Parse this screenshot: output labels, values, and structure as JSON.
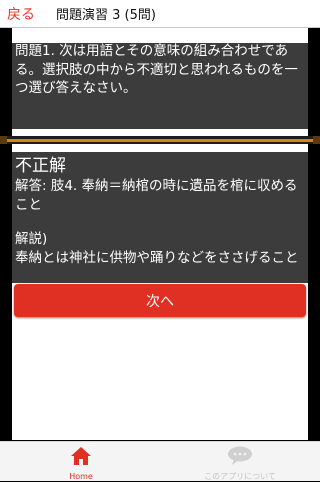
{
  "header": {
    "back_label": "戻る",
    "title": "問題演習 3 (5問)"
  },
  "question": {
    "text": "問題1. 次は用語とその意味の組み合わせである。選択肢の中から不適切と思われるものを一つ選び答えなさい。"
  },
  "result": {
    "title": "不正解",
    "answer": "解答: 肢4. 奉納＝納棺の時に遺品を棺に収めること",
    "explain_label": "解説)",
    "explain": "奉納とは神社に供物や踊りなどをささげること"
  },
  "next_button": {
    "label": "次へ"
  },
  "bottom_nav": {
    "home_label": "Home",
    "about_label": "このアプリについて"
  },
  "colors": {
    "accent": "#e03024",
    "box": "#3c3c3c",
    "divider": "#d98018"
  },
  "icons": {
    "home": "home-icon",
    "about": "speech-bubble-icon"
  }
}
